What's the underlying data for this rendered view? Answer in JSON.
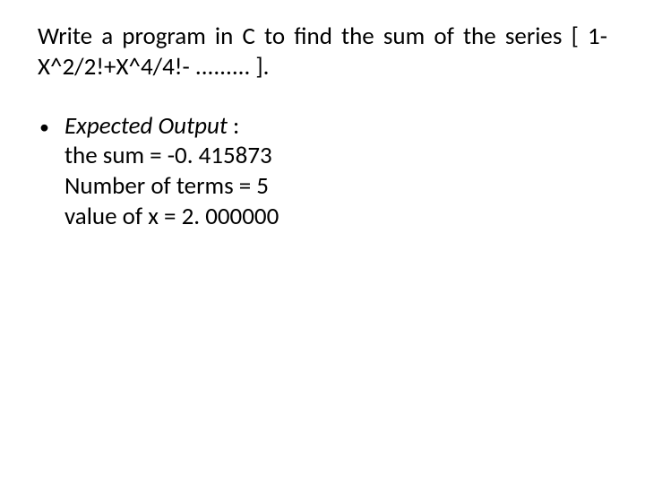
{
  "title": "Write a program in C to find the sum of the series [ 1-X^2/2!+X^4/4!- ......... ].",
  "bullet_label": "Expected Output",
  "colon": " :",
  "lines": {
    "l1": "the sum = -0. 415873",
    "l2": "Number of terms = 5",
    "l3": "value of x = 2. 000000"
  }
}
